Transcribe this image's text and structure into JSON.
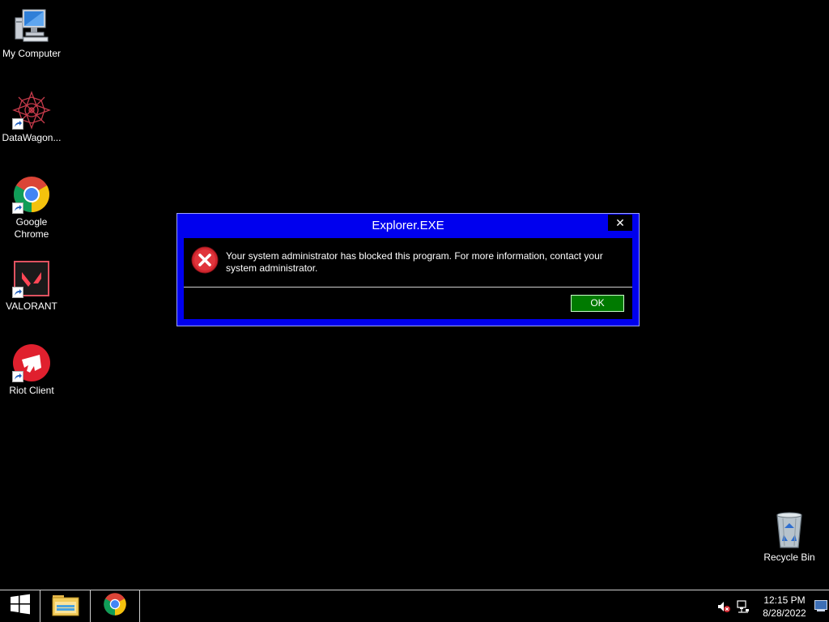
{
  "desktop": {
    "icons": [
      {
        "label": "My Computer",
        "icon": "computer-icon"
      },
      {
        "label": "DataWagon...",
        "icon": "datawagon-icon"
      },
      {
        "label": "Google Chrome",
        "icon": "chrome-icon"
      },
      {
        "label": "VALORANT",
        "icon": "valorant-icon"
      },
      {
        "label": "Riot Client",
        "icon": "riot-client-icon"
      },
      {
        "label": "Recycle Bin",
        "icon": "recycle-bin-icon"
      }
    ]
  },
  "dialog": {
    "title": "Explorer.EXE",
    "close_label": "✕",
    "message": "Your system administrator has blocked this program. For more information, contact your system administrator.",
    "ok_label": "OK",
    "icon": "error-icon"
  },
  "taskbar": {
    "start_icon": "windows-start-icon",
    "pinned": [
      "file-explorer-icon",
      "chrome-icon"
    ],
    "tray": [
      "volume-muted-icon",
      "network-icon"
    ],
    "time": "12:15 PM",
    "date": "8/28/2022"
  },
  "colors": {
    "dialog_frame": "#0000ee",
    "ok_button": "#007a00",
    "error_red": "#d0262e"
  }
}
